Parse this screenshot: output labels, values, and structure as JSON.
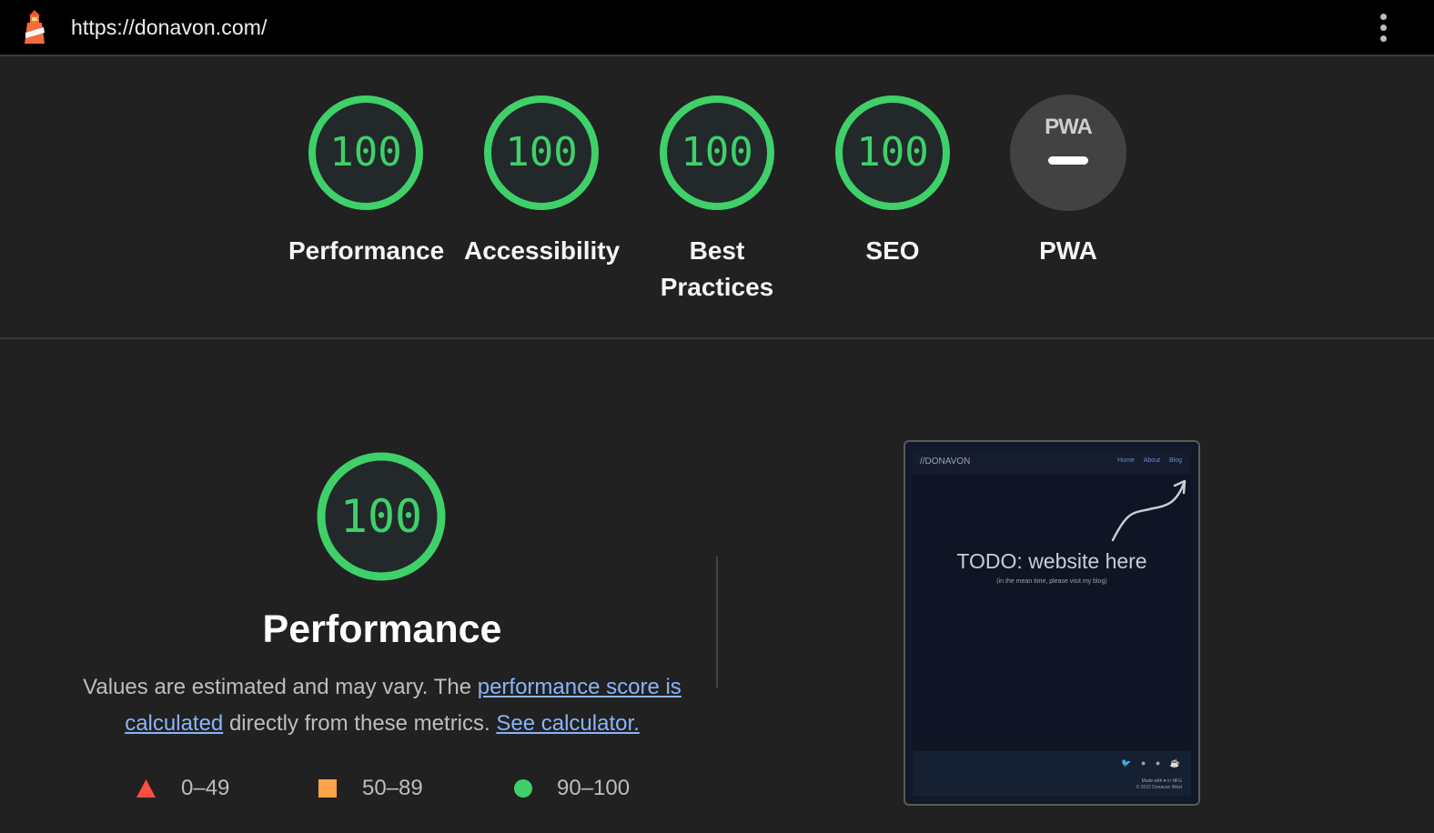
{
  "header": {
    "url": "https://donavon.com/",
    "logo_icon": "lighthouse-icon",
    "menu_icon": "more-vert-icon"
  },
  "colors": {
    "pass": "#3fd06a",
    "average": "#ffa24b",
    "fail": "#ff4e42",
    "link": "#8ab4f8"
  },
  "gauges": [
    {
      "label": "Performance",
      "score": "100"
    },
    {
      "label": "Accessibility",
      "score": "100"
    },
    {
      "label": "Best Practices",
      "score": "100"
    },
    {
      "label": "SEO",
      "score": "100"
    },
    {
      "label": "PWA",
      "score": "",
      "badge": "PWA"
    }
  ],
  "performance": {
    "score": "100",
    "title": "Performance",
    "desc_prefix": "Values are estimated and may vary. The ",
    "link_calc": "performance score is calculated",
    "desc_middle": " directly from these metrics. ",
    "link_calculator": "See calculator."
  },
  "legend": [
    {
      "range": "0–49",
      "icon": "triangle-icon"
    },
    {
      "range": "50–89",
      "icon": "square-icon"
    },
    {
      "range": "90–100",
      "icon": "circle-icon"
    }
  ],
  "screenshot": {
    "brand": "//DONAVON",
    "nav": [
      "Home",
      "About",
      "Blog"
    ],
    "headline": "TODO: website here",
    "subline": "(in the mean time, please visit my blog)",
    "footer_made": "Made with ♥ in NFG",
    "footer_copy": "© 2022 Donavon West"
  }
}
